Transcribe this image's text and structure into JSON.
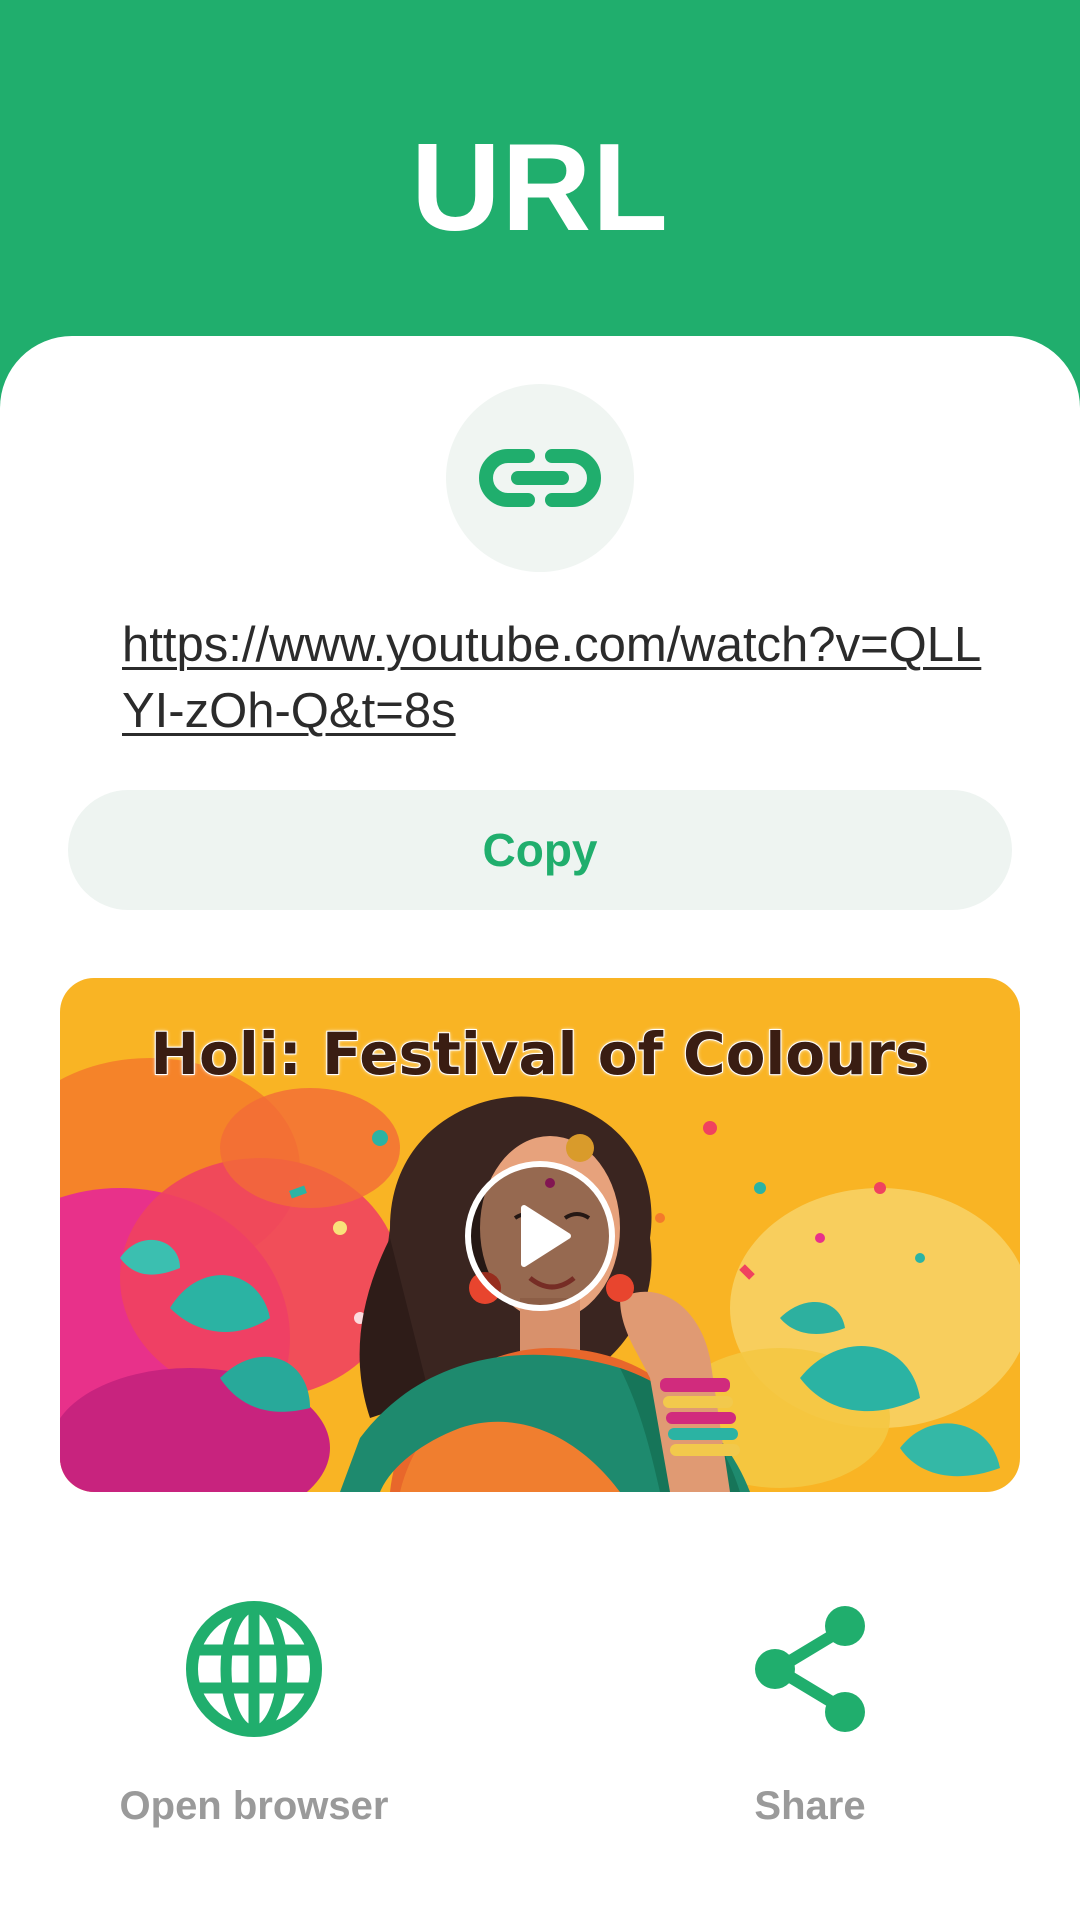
{
  "header": {
    "title": "URL"
  },
  "url": {
    "value": "https://www.youtube.com/watch?v=QLLYI-zOh-Q&t=8s"
  },
  "actions": {
    "copy_label": "Copy",
    "open_browser_label": "Open browser",
    "share_label": "Share"
  },
  "video": {
    "thumbnail_title": "Holi: Festival of Colours"
  },
  "colors": {
    "brand_green": "#20AE6D",
    "card_background": "#FFFFFF",
    "soft_background": "#EEF4F1",
    "label_gray": "#9A9A9A",
    "thumbnail_yellow": "#F9B424"
  },
  "icons": {
    "link": "link-icon",
    "play": "play-icon",
    "globe": "globe-icon",
    "share": "share-icon"
  }
}
